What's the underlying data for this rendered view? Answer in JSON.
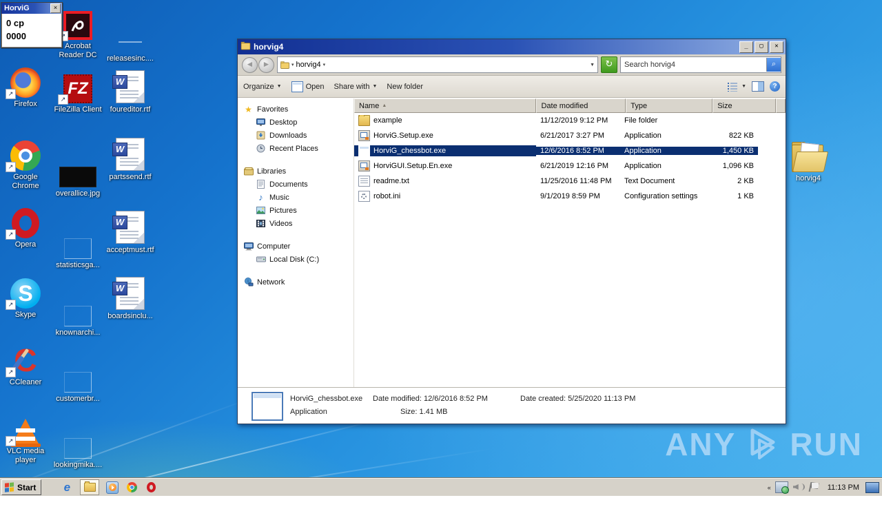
{
  "widget": {
    "title": "HorviG",
    "close_label": "×",
    "line1": "0 cp",
    "line2": "0000"
  },
  "desktop": {
    "icons": [
      {
        "label": "Firefox"
      },
      {
        "label": "Google Chrome"
      },
      {
        "label": "Opera"
      },
      {
        "label": "Skype"
      },
      {
        "label": "CCleaner"
      },
      {
        "label": "VLC media player"
      },
      {
        "label": "Acrobat Reader DC"
      },
      {
        "label": "FileZilla Client"
      },
      {
        "label": "overallice.jpg"
      },
      {
        "label": "statisticsga..."
      },
      {
        "label": "knownarchi..."
      },
      {
        "label": "customerbr..."
      },
      {
        "label": "lookingmika...."
      },
      {
        "label": "releasesinc...."
      },
      {
        "label": "foureditor.rtf"
      },
      {
        "label": "partssend.rtf"
      },
      {
        "label": "acceptmust.rtf"
      },
      {
        "label": "boardsinclu..."
      },
      {
        "label": "horvig4"
      }
    ],
    "watermark": {
      "any": "ANY",
      "run": "RUN"
    }
  },
  "explorer": {
    "title": "horvig4",
    "controls": {
      "minimize": "_",
      "maximize": "▢",
      "close": "✕"
    },
    "address": {
      "back": "◄",
      "forward": "►",
      "crumb": "horvig4",
      "dropdown": "▼",
      "refresh": "↻",
      "search_text": "Search horvig4",
      "search_icon": "🔍"
    },
    "toolbar": {
      "organize": "Organize",
      "open": "Open",
      "share": "Share with",
      "new_folder": "New folder"
    },
    "sidebar": {
      "favorites": {
        "label": "Favorites",
        "items": [
          "Desktop",
          "Downloads",
          "Recent Places"
        ]
      },
      "libraries": {
        "label": "Libraries",
        "items": [
          "Documents",
          "Music",
          "Pictures",
          "Videos"
        ]
      },
      "computer": {
        "label": "Computer",
        "items": [
          "Local Disk (C:)"
        ]
      },
      "network": {
        "label": "Network"
      }
    },
    "list": {
      "columns": [
        "Name",
        "Date modified",
        "Type",
        "Size"
      ],
      "sort_indicator": "▲",
      "rows": [
        {
          "name": "example",
          "modified": "11/12/2019 9:12 PM",
          "type": "File folder",
          "size": ""
        },
        {
          "name": "HorviG.Setup.exe",
          "modified": "6/21/2017 3:27 PM",
          "type": "Application",
          "size": "822 KB"
        },
        {
          "name": "HorviG_chessbot.exe",
          "modified": "12/6/2016 8:52 PM",
          "type": "Application",
          "size": "1,450 KB"
        },
        {
          "name": "HorviGUI.Setup.En.exe",
          "modified": "6/21/2019 12:16 PM",
          "type": "Application",
          "size": "1,096 KB"
        },
        {
          "name": "readme.txt",
          "modified": "11/25/2016 11:48 PM",
          "type": "Text Document",
          "size": "2 KB"
        },
        {
          "name": "robot.ini",
          "modified": "9/1/2019 8:59 PM",
          "type": "Configuration settings",
          "size": "1 KB"
        }
      ]
    },
    "details": {
      "name": "HorviG_chessbot.exe",
      "type": "Application",
      "modified": "Date modified: 12/6/2016 8:52 PM",
      "size": "Size: 1.41 MB",
      "created": "Date created: 5/25/2020 11:13 PM"
    }
  },
  "taskbar": {
    "start": "Start",
    "clock": "11:13 PM"
  }
}
